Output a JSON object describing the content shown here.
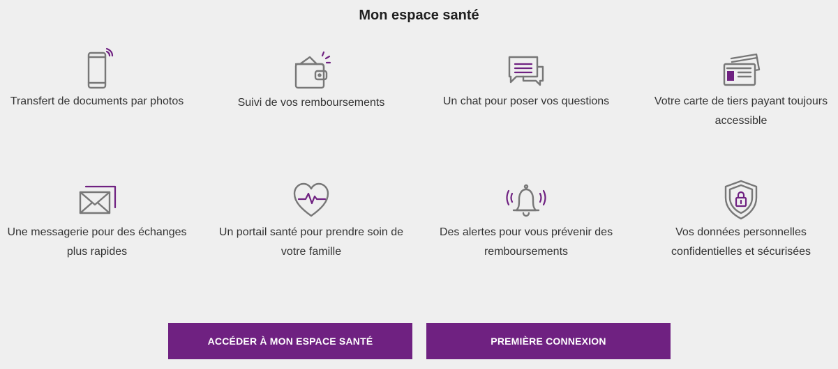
{
  "page": {
    "title": "Mon espace santé"
  },
  "features": [
    {
      "label": "Transfert de documents par photos",
      "icon": "phone-icon"
    },
    {
      "label": "Suivi de vos remboursements",
      "icon": "wallet-icon"
    },
    {
      "label": "Un chat pour poser vos questions",
      "icon": "chat-icon"
    },
    {
      "label": "Votre carte de tiers payant toujours accessible",
      "icon": "card-icon"
    },
    {
      "label": "Une messagerie pour des échanges plus rapides",
      "icon": "mail-icon"
    },
    {
      "label": "Un portail santé pour prendre soin de votre famille",
      "icon": "heart-pulse-icon"
    },
    {
      "label": "Des alertes pour vous prévenir des remboursements",
      "icon": "bell-icon"
    },
    {
      "label": "Vos données personnelles confidentielles et sécurisées",
      "icon": "shield-lock-icon"
    }
  ],
  "buttons": {
    "access_label": "ACCÉDER À MON ESPACE SANTÉ",
    "first_login_label": "PREMIÈRE CONNEXION"
  },
  "colors": {
    "accent": "#6f2181",
    "icon_gray": "#777777",
    "background": "#efefef"
  }
}
